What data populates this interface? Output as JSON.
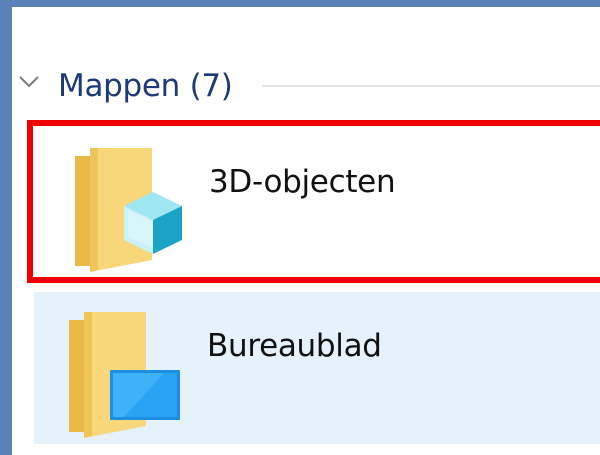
{
  "group": {
    "title": "Mappen (7)",
    "expanded": true
  },
  "folders": [
    {
      "label": "3D-objecten",
      "icon": "folder-3d-objects-icon",
      "highlighted": true,
      "selected": false
    },
    {
      "label": "Bureaublad",
      "icon": "folder-desktop-icon",
      "highlighted": false,
      "selected": true
    }
  ],
  "colors": {
    "frame": "#5a82b8",
    "group_title": "#1e3a78",
    "highlight_border": "#ee0000",
    "selection_background": "#e5f1fb",
    "folder_yellow": "#f5cf6a",
    "cube_cyan": "#35b9d9",
    "desktop_blue": "#1c8fe3"
  }
}
